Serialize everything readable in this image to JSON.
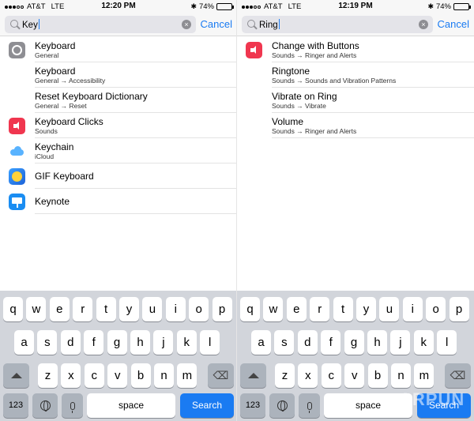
{
  "left": {
    "status": {
      "carrier": "AT&T",
      "network": "LTE",
      "time": "12:20 PM",
      "battery": "74%",
      "battery_level": 0.74
    },
    "search": {
      "query": "Key",
      "cancel": "Cancel"
    },
    "results": [
      {
        "title": "Keyboard",
        "subtitle": "General",
        "icon": "gear-icon"
      },
      {
        "title": "Keyboard",
        "subtitle": "General → Accessibility",
        "icon": ""
      },
      {
        "title": "Reset Keyboard Dictionary",
        "subtitle": "General → Reset",
        "icon": ""
      },
      {
        "title": "Keyboard Clicks",
        "subtitle": "Sounds",
        "icon": "speaker-icon"
      },
      {
        "title": "Keychain",
        "subtitle": "iCloud",
        "icon": "cloud-icon"
      },
      {
        "title": "GIF Keyboard",
        "subtitle": "",
        "icon": "gif-keyboard-icon"
      },
      {
        "title": "Keynote",
        "subtitle": "",
        "icon": "keynote-icon"
      }
    ],
    "keyboard": {
      "row1": [
        "q",
        "w",
        "e",
        "r",
        "t",
        "y",
        "u",
        "i",
        "o",
        "p"
      ],
      "row2": [
        "a",
        "s",
        "d",
        "f",
        "g",
        "h",
        "j",
        "k",
        "l"
      ],
      "row3": [
        "z",
        "x",
        "c",
        "v",
        "b",
        "n",
        "m"
      ],
      "numbers": "123",
      "space": "space",
      "action": "Search"
    }
  },
  "right": {
    "status": {
      "carrier": "AT&T",
      "network": "LTE",
      "time": "12:19 PM",
      "battery": "74%",
      "battery_level": 0.74
    },
    "search": {
      "query": "Ring",
      "cancel": "Cancel"
    },
    "results": [
      {
        "title": "Change with Buttons",
        "subtitle": "Sounds → Ringer and Alerts",
        "icon": "speaker-icon"
      },
      {
        "title": "Ringtone",
        "subtitle": "Sounds → Sounds and Vibration Patterns",
        "icon": ""
      },
      {
        "title": "Vibrate on Ring",
        "subtitle": "Sounds → Vibrate",
        "icon": ""
      },
      {
        "title": "Volume",
        "subtitle": "Sounds → Ringer and Alerts",
        "icon": ""
      }
    ],
    "keyboard": {
      "row1": [
        "q",
        "w",
        "e",
        "r",
        "t",
        "y",
        "u",
        "i",
        "o",
        "p"
      ],
      "row2": [
        "a",
        "s",
        "d",
        "f",
        "g",
        "h",
        "j",
        "k",
        "l"
      ],
      "row3": [
        "z",
        "x",
        "c",
        "v",
        "b",
        "n",
        "m"
      ],
      "numbers": "123",
      "space": "space",
      "action": "Search"
    }
  },
  "watermark": "ARPUN"
}
